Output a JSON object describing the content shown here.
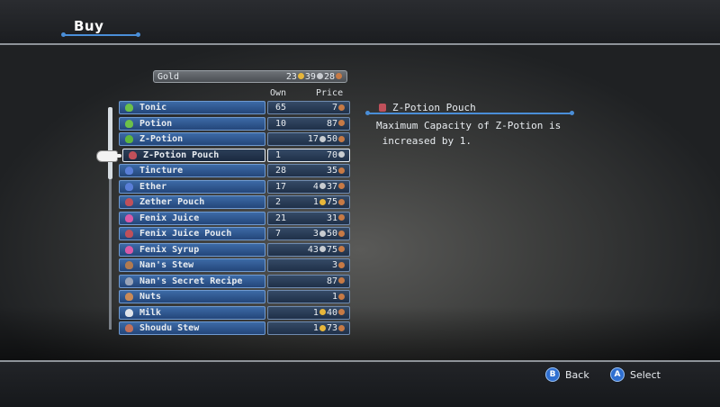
{
  "header": {
    "title": "Buy"
  },
  "gold": {
    "label": "Gold",
    "gold": "23",
    "silver": "39",
    "copper": "28"
  },
  "columns": {
    "own": "Own",
    "price": "Price"
  },
  "items": [
    {
      "name": "Tonic",
      "own": "65",
      "price": "7",
      "coins": [
        "c"
      ],
      "icon": "potion-green-icon",
      "icolor": "#6cc04a"
    },
    {
      "name": "Potion",
      "own": "10",
      "price": "87",
      "coins": [
        "c"
      ],
      "icon": "potion-green-icon",
      "icolor": "#6cc04a"
    },
    {
      "name": "Z-Potion",
      "own": "",
      "price": "17",
      "price2": "50",
      "coins": [
        "s",
        "c"
      ],
      "icon": "potion-green-icon",
      "icolor": "#5fb83d"
    },
    {
      "name": "Z-Potion Pouch",
      "own": "1",
      "price": "70",
      "coins": [
        "s"
      ],
      "icon": "pouch-icon",
      "icolor": "#c0505a",
      "selected": true
    },
    {
      "name": "Tincture",
      "own": "28",
      "price": "35",
      "coins": [
        "c"
      ],
      "icon": "potion-blue-icon",
      "icolor": "#5a7fd8"
    },
    {
      "name": "Ether",
      "own": "17",
      "price": "4",
      "price2": "37",
      "coins": [
        "s",
        "c"
      ],
      "icon": "potion-blue-icon",
      "icolor": "#5a7fd8"
    },
    {
      "name": "Zether Pouch",
      "own": "2",
      "price": "1",
      "price2": "75",
      "coins": [
        "g",
        "c"
      ],
      "icon": "pouch-icon",
      "icolor": "#c0505a"
    },
    {
      "name": "Fenix Juice",
      "own": "21",
      "price": "31",
      "coins": [
        "c"
      ],
      "icon": "potion-pink-icon",
      "icolor": "#d85aa8"
    },
    {
      "name": "Fenix Juice Pouch",
      "own": "7",
      "price": "3",
      "price2": "50",
      "coins": [
        "s",
        "c"
      ],
      "icon": "pouch-icon",
      "icolor": "#c0505a"
    },
    {
      "name": "Fenix Syrup",
      "own": "",
      "price": "43",
      "price2": "75",
      "coins": [
        "s",
        "c"
      ],
      "icon": "potion-pink-icon",
      "icolor": "#d85aa8"
    },
    {
      "name": "Nan's Stew",
      "own": "",
      "price": "3",
      "coins": [
        "c"
      ],
      "icon": "jar-icon",
      "icolor": "#b07a50"
    },
    {
      "name": "Nan's Secret Recipe",
      "own": "",
      "price": "87",
      "coins": [
        "c"
      ],
      "icon": "jar-icon",
      "icolor": "#9aa4b8"
    },
    {
      "name": "Nuts",
      "own": "",
      "price": "1",
      "coins": [
        "c"
      ],
      "icon": "nuts-icon",
      "icolor": "#c88a58"
    },
    {
      "name": "Milk",
      "own": "",
      "price": "1",
      "price2": "40",
      "coins": [
        "g",
        "c"
      ],
      "icon": "bottle-icon",
      "icolor": "#e0e4ea"
    },
    {
      "name": "Shoudu Stew",
      "own": "",
      "price": "1",
      "price2": "73",
      "coins": [
        "g",
        "c"
      ],
      "icon": "pot-icon",
      "icolor": "#c0705a"
    }
  ],
  "description": {
    "title": "Z-Potion Pouch",
    "text": "Maximum Capacity of Z-Potion is\n increased by 1."
  },
  "footer": {
    "back_button": "B",
    "back_label": "Back",
    "select_button": "A",
    "select_label": "Select"
  }
}
